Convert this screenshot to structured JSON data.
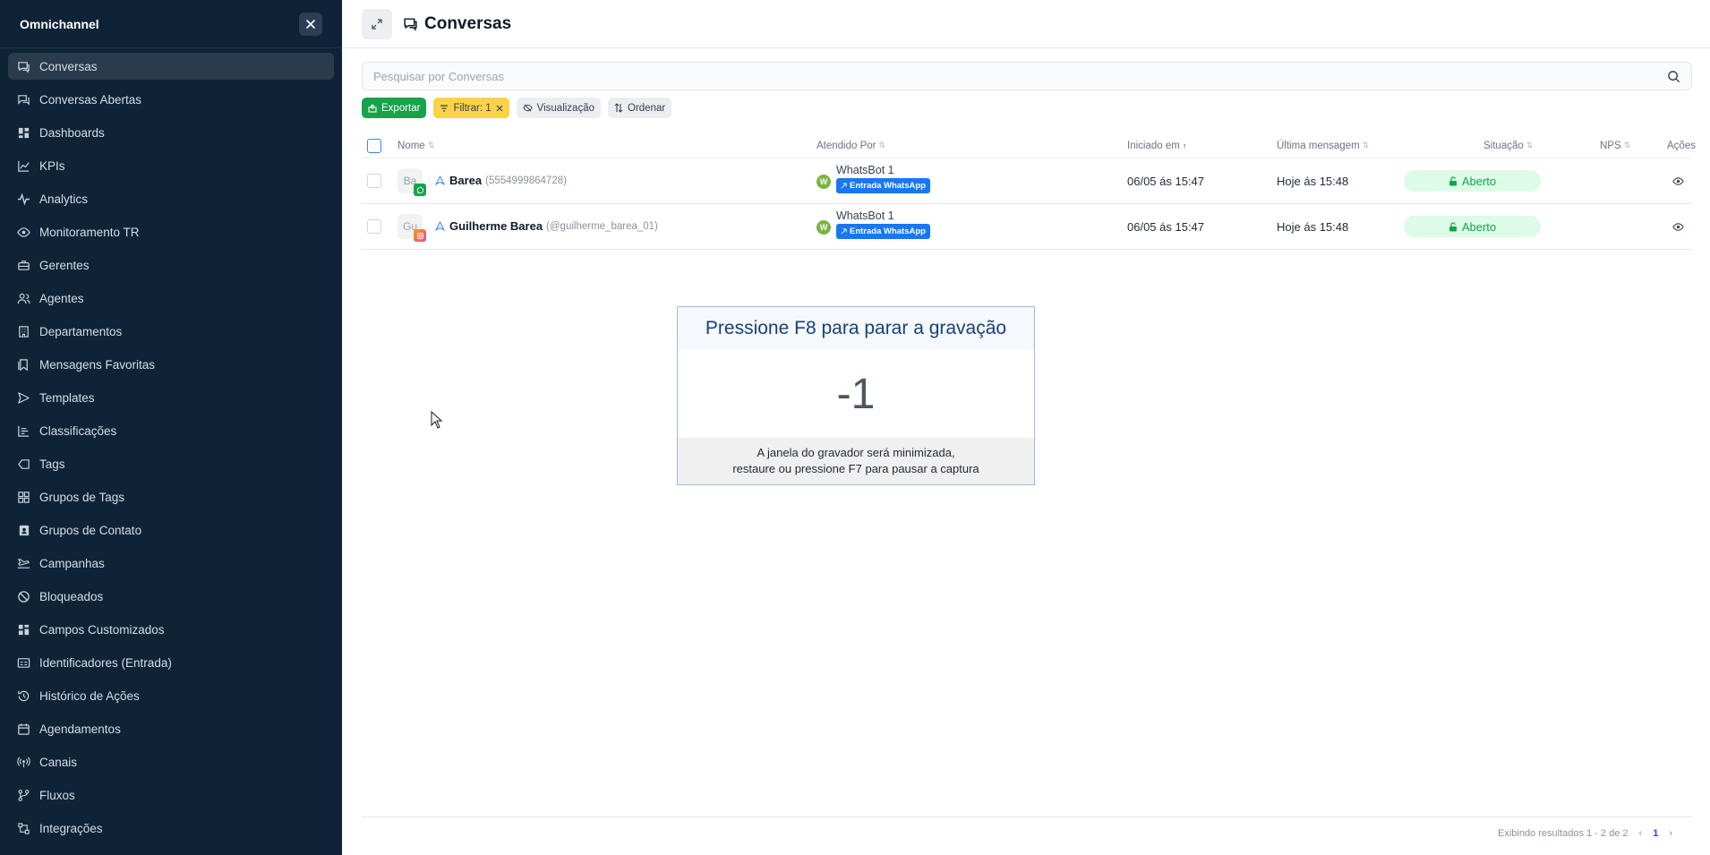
{
  "sidebar": {
    "title": "Omnichannel",
    "items": [
      {
        "label": "Conversas",
        "icon": "chat-icon"
      },
      {
        "label": "Conversas Abertas",
        "icon": "chat-open-icon"
      },
      {
        "label": "Dashboards",
        "icon": "dashboard-icon"
      },
      {
        "label": "KPIs",
        "icon": "line-chart-icon"
      },
      {
        "label": "Analytics",
        "icon": "pulse-icon"
      },
      {
        "label": "Monitoramento TR",
        "icon": "eye-icon"
      },
      {
        "label": "Gerentes",
        "icon": "briefcase-icon"
      },
      {
        "label": "Agentes",
        "icon": "users-icon"
      },
      {
        "label": "Departamentos",
        "icon": "building-icon"
      },
      {
        "label": "Mensagens Favoritas",
        "icon": "bookmark-icon"
      },
      {
        "label": "Templates",
        "icon": "send-icon"
      },
      {
        "label": "Classificações",
        "icon": "list-icon"
      },
      {
        "label": "Tags",
        "icon": "tag-icon"
      },
      {
        "label": "Grupos de Tags",
        "icon": "grid-icon"
      },
      {
        "label": "Grupos de Contato",
        "icon": "contact-book-icon"
      },
      {
        "label": "Campanhas",
        "icon": "plane-icon"
      },
      {
        "label": "Bloqueados",
        "icon": "ban-icon"
      },
      {
        "label": "Campos Customizados",
        "icon": "layout-icon"
      },
      {
        "label": "Identificadores (Entrada)",
        "icon": "id-card-icon"
      },
      {
        "label": "Histórico de Ações",
        "icon": "history-icon"
      },
      {
        "label": "Agendamentos",
        "icon": "calendar-icon"
      },
      {
        "label": "Canais",
        "icon": "broadcast-icon"
      },
      {
        "label": "Fluxos",
        "icon": "flow-icon"
      },
      {
        "label": "Integrações",
        "icon": "integration-icon"
      }
    ]
  },
  "header": {
    "title": "Conversas"
  },
  "search": {
    "placeholder": "Pesquisar por Conversas"
  },
  "toolbar": {
    "export_label": "Exportar",
    "filter_label": "Filtrar: 1",
    "view_label": "Visualização",
    "sort_label": "Ordenar"
  },
  "table": {
    "headers": {
      "name": "Nome",
      "attended_by": "Atendido Por",
      "started": "Iniciado em",
      "last_message": "Última mensagem",
      "status": "Situação",
      "nps": "NPS",
      "actions": "Ações"
    },
    "rows": [
      {
        "avatar": "Ba",
        "channel": "whatsapp",
        "name": "Barea",
        "identifier": "(5554999864728)",
        "bot_initial": "W",
        "bot": "WhatsBot 1",
        "tag": "Entrada WhatsApp",
        "started": "06/05 ás 15:47",
        "last_message": "Hoje ás 15:48",
        "status": "Aberto"
      },
      {
        "avatar": "Gu",
        "channel": "instagram",
        "name": "Guilherme Barea",
        "identifier": "(@guilherme_barea_01)",
        "bot_initial": "W",
        "bot": "WhatsBot 1",
        "tag": "Entrada WhatsApp",
        "started": "06/05 ás 15:47",
        "last_message": "Hoje ás 15:48",
        "status": "Aberto"
      }
    ]
  },
  "recorder": {
    "title": "Pressione F8 para parar a gravação",
    "countdown": "-1",
    "line1": "A janela do gravador será minimizada,",
    "line2": "restaure ou pressione F7 para pausar a captura"
  },
  "pagination": {
    "summary": "Exibindo resultados 1 - 2 de 2",
    "prev": "‹",
    "page": "1",
    "next": "›"
  },
  "colors": {
    "sidebar_bg": "#0f2337",
    "export": "#16a34a",
    "filter": "#fbd24a",
    "status_bg": "#dcfce7",
    "tag": "#1877f2"
  }
}
